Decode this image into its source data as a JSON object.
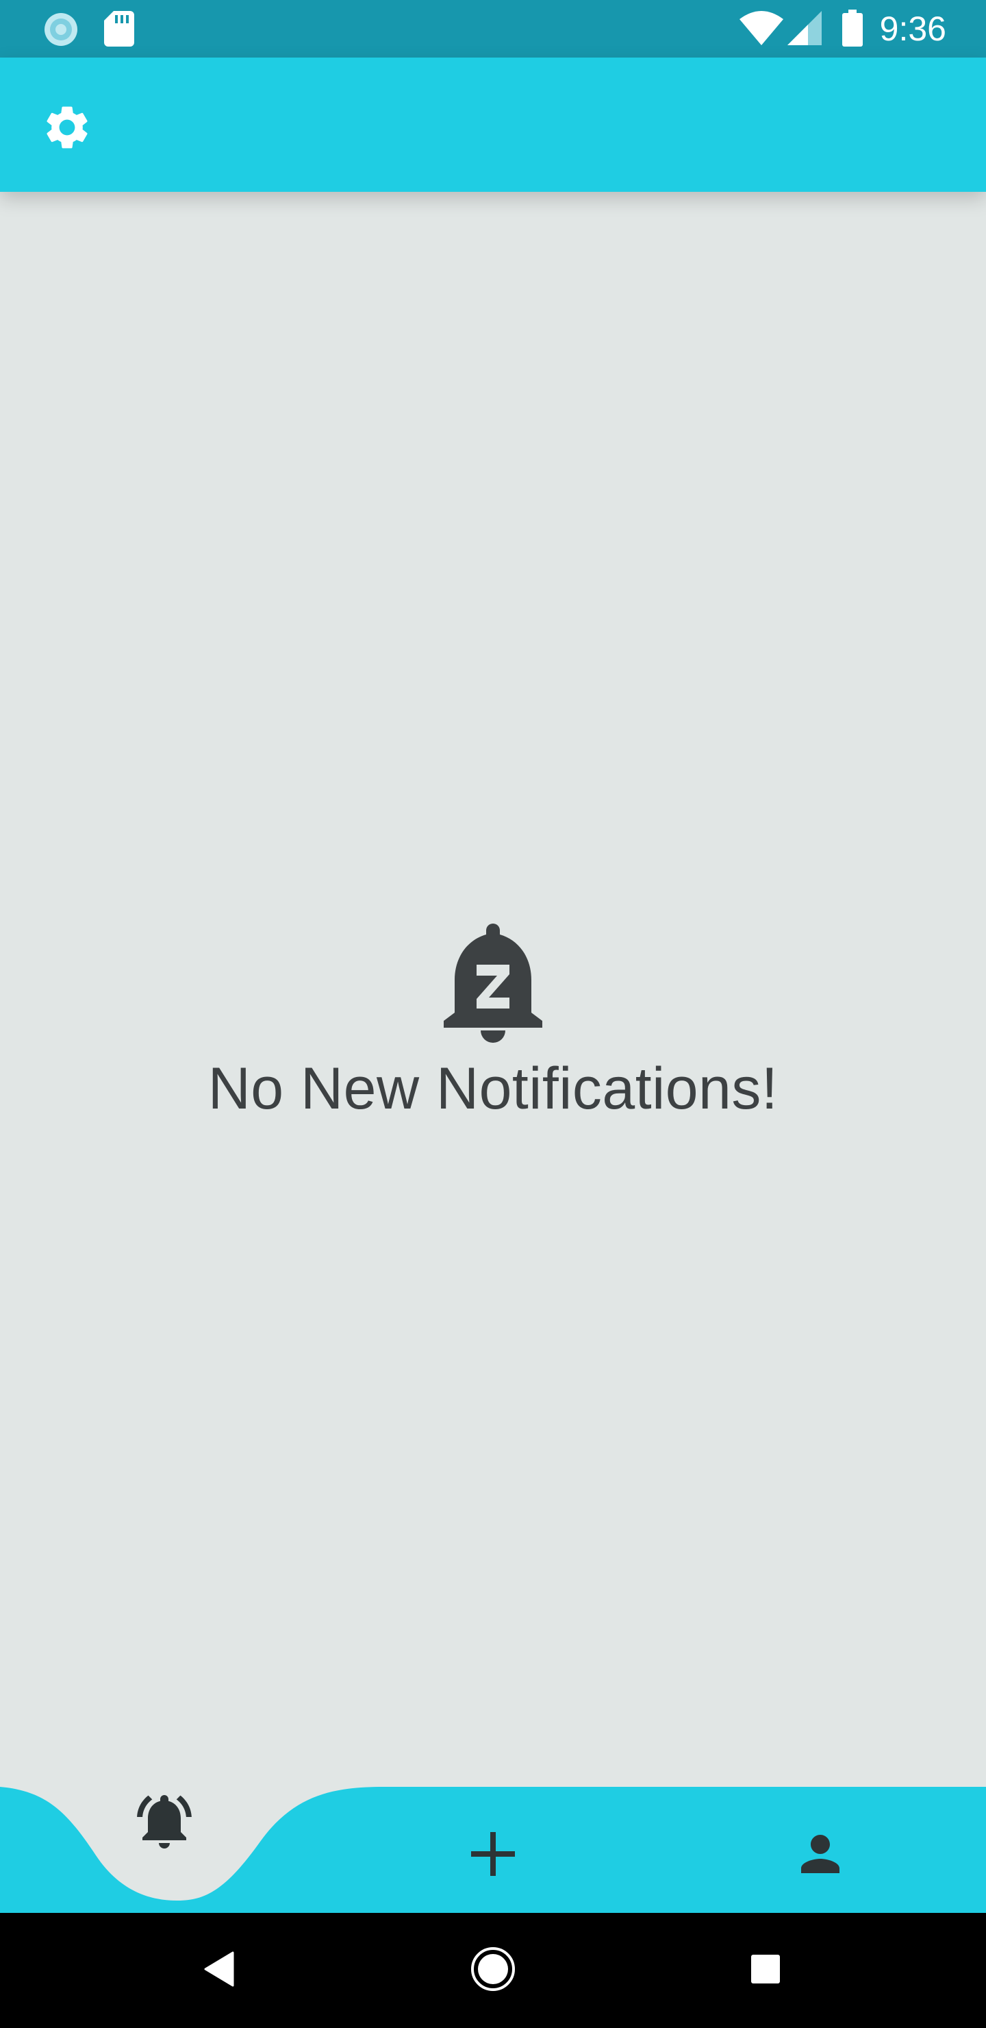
{
  "status_bar": {
    "time": "9:36",
    "icons": [
      "loading-icon",
      "sd-card-icon",
      "wifi-icon",
      "cell-signal-icon",
      "battery-icon"
    ]
  },
  "app_bar": {
    "settings_icon": "gear-icon",
    "color": "#1fcde3"
  },
  "empty_state": {
    "icon": "bell-snooze-icon",
    "message": "No New Notifications!"
  },
  "bottom_nav": {
    "items": [
      {
        "icon": "notifications-bell-icon",
        "active": true
      },
      {
        "icon": "plus-icon",
        "active": false
      },
      {
        "icon": "person-icon",
        "active": false
      }
    ],
    "color": "#1fcde3"
  },
  "system_nav": {
    "buttons": [
      "back-icon",
      "home-icon",
      "recents-icon"
    ]
  },
  "colors": {
    "status_bar": "#1797ad",
    "accent": "#1fcde3",
    "background": "#e1e6e5",
    "icon_dark": "#3d4143"
  }
}
